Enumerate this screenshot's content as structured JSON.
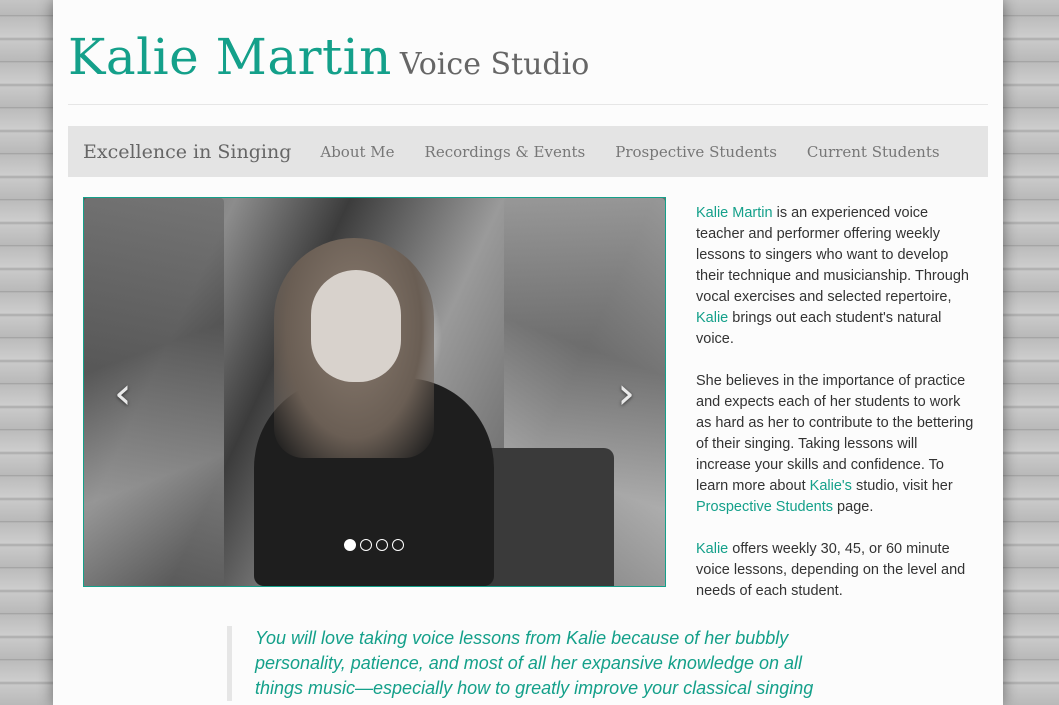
{
  "header": {
    "name": "Kalie Martin",
    "subtitle": "Voice Studio"
  },
  "nav": {
    "brand": "Excellence in Singing",
    "items": [
      {
        "label": "About Me"
      },
      {
        "label": "Recordings & Events"
      },
      {
        "label": "Prospective Students"
      },
      {
        "label": "Current Students"
      }
    ]
  },
  "carousel": {
    "prev_glyph": "‹",
    "next_glyph": "›",
    "slides": 4,
    "active_slide": 1
  },
  "intro": {
    "p1": {
      "name": "Kalie Martin",
      "a": " is an experienced voice teacher and performer offering weekly lessons to singers who want to develop their technique and musicianship. Through vocal exercises and selected repertoire, ",
      "name2": "Kalie",
      "b": " brings out each student's natural voice."
    },
    "p2": {
      "a": "She believes in the importance of practice and expects each of her students to work as hard as her to contribute to the bettering of their singing. Taking lessons will increase your skills and confidence. To learn more about ",
      "name": "Kalie's",
      "b": " studio, visit her ",
      "link": "Prospective Students",
      "c": " page."
    },
    "p3": {
      "name": "Kalie",
      "a": " offers weekly 30, 45, or 60 minute voice lessons, depending on the level and needs of each student."
    }
  },
  "quote": {
    "text": "You will love taking voice lessons from Kalie because of her bubbly personality, patience, and most of all her expansive knowledge on all things music—especially how to greatly improve your classical singing"
  },
  "colors": {
    "accent": "#14a08a",
    "nav_bg": "#e4e4e4"
  }
}
